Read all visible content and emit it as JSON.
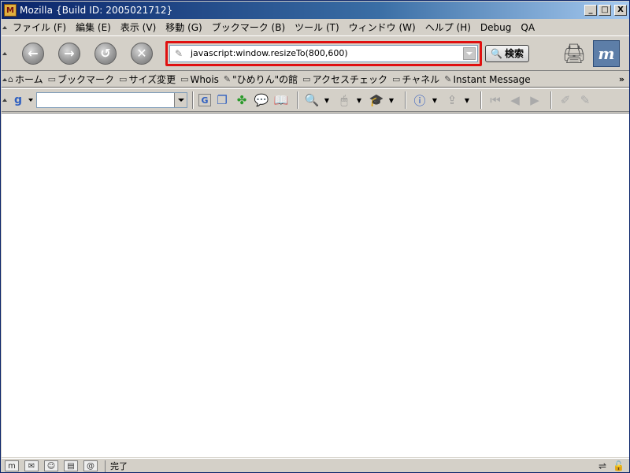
{
  "window": {
    "title": "Mozilla {Build ID: 2005021712}",
    "controls": {
      "minimize": "_",
      "maximize": "□",
      "close": "X"
    }
  },
  "menu": [
    "ファイル (F)",
    "編集 (E)",
    "表示 (V)",
    "移動 (G)",
    "ブックマーク (B)",
    "ツール (T)",
    "ウィンドウ (W)",
    "ヘルプ (H)",
    "Debug",
    "QA"
  ],
  "navigation": {
    "back_glyph": "←",
    "forward_glyph": "→",
    "reload_glyph": "↺",
    "stop_glyph": "✕",
    "url_value": "javascript:window.resizeTo(800,600)",
    "search_label": "検索",
    "logo_text": "m"
  },
  "bookmarks": [
    {
      "icon": "home-icon",
      "label": "ホーム"
    },
    {
      "icon": "folder-icon",
      "label": "ブックマーク"
    },
    {
      "icon": "folder-icon",
      "label": "サイズ変更"
    },
    {
      "icon": "folder-icon",
      "label": "Whois"
    },
    {
      "icon": "bookmark-icon",
      "label": "\"ひめりん\"の館"
    },
    {
      "icon": "folder-icon",
      "label": "アクセスチェック"
    },
    {
      "icon": "folder-icon",
      "label": "チャネル"
    },
    {
      "icon": "bookmark-icon",
      "label": "Instant Message"
    }
  ],
  "bookmarks_more": "»",
  "google_toolbar": {
    "logo": "g",
    "search_value": ""
  },
  "status": {
    "text": "完了"
  },
  "colors": {
    "title_gradient_start": "#0a246a",
    "highlight_border": "#e01010",
    "chrome": "#d4d0c8"
  }
}
